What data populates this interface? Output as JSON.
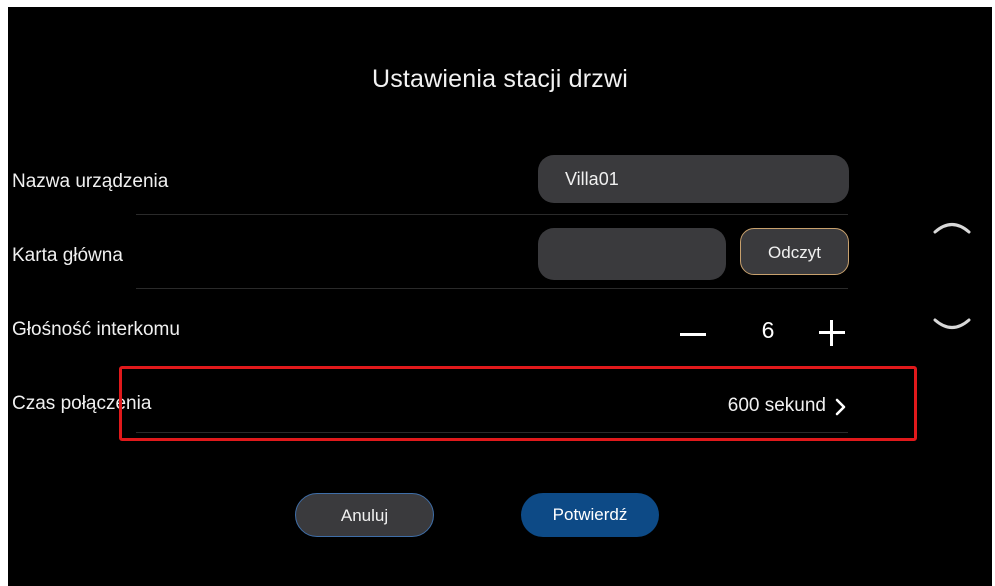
{
  "title": "Ustawienia stacji drzwi",
  "rows": {
    "device_name": {
      "label": "Nazwa urządzenia",
      "value": "Villa01"
    },
    "master_card": {
      "label": "Karta główna",
      "value": "",
      "read_button": "Odczyt"
    },
    "intercom_volume": {
      "label": "Głośność interkomu",
      "value": "6"
    },
    "call_time": {
      "label": "Czas połączenia",
      "value": "600 sekund"
    }
  },
  "buttons": {
    "cancel": "Anuluj",
    "confirm": "Potwierdź"
  },
  "icons": {
    "decrease": "minus-icon",
    "increase": "plus-icon",
    "chevron": "chevron-right-icon",
    "scroll_up": "chevron-up-icon",
    "scroll_down": "chevron-down-icon"
  },
  "colors": {
    "background": "#000000",
    "input_background": "#3a3a3d",
    "confirm_button": "#0d4a86",
    "read_button_border": "#c7a06d",
    "cancel_button_border": "#3f6ea8",
    "highlight_border": "#e0191b"
  }
}
